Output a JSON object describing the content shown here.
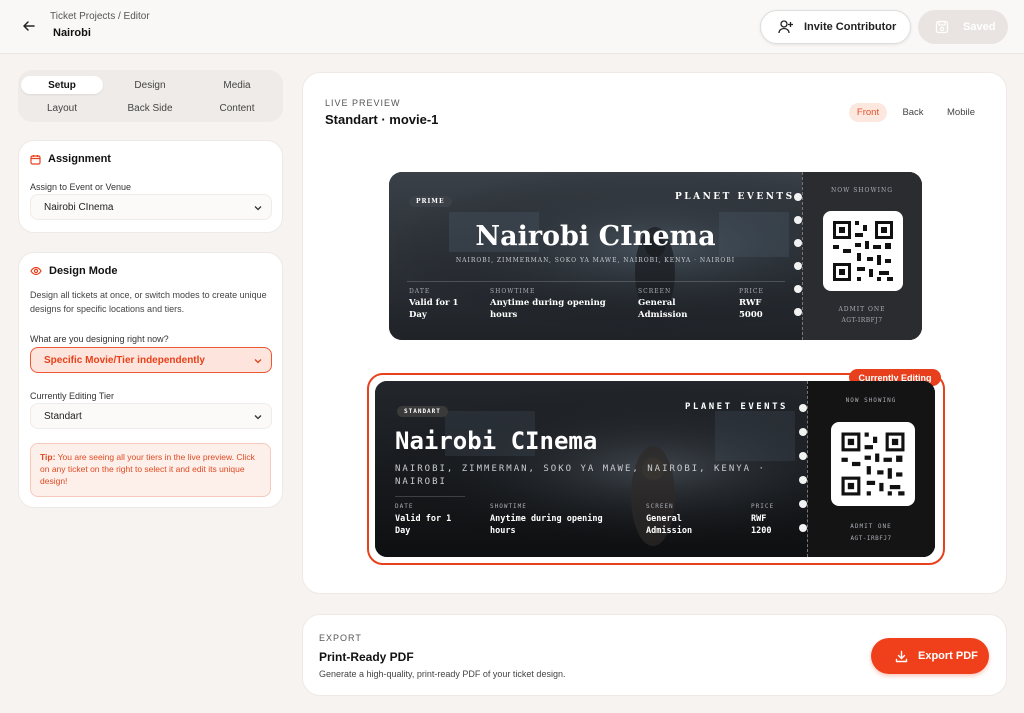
{
  "header": {
    "breadcrumb": "Ticket Projects / Editor",
    "title": "Nairobi",
    "invite_label": "Invite Contributor",
    "saved_label": "Saved"
  },
  "tabs": [
    "Setup",
    "Design",
    "Media",
    "Layout",
    "Back Side",
    "Content"
  ],
  "assignment": {
    "heading": "Assignment",
    "label": "Assign to Event or Venue",
    "value": "Nairobi CInema"
  },
  "design_mode": {
    "heading": "Design Mode",
    "description": "Design all tickets at once, or switch modes to create unique designs for specific locations and tiers.",
    "question": "What are you designing right now?",
    "mode_value": "Specific Movie/Tier independently",
    "tier_label": "Currently Editing Tier",
    "tier_value": "Standart",
    "tip_label": "Tip:",
    "tip_text": " You are seeing all your tiers in the live preview. Click on any ticket on the right to select it and edit its unique design!"
  },
  "preview": {
    "label": "LIVE PREVIEW",
    "title": "Standart · movie-1",
    "views": [
      "Front",
      "Back",
      "Mobile"
    ]
  },
  "ticket_prime": {
    "badge": "PRIME",
    "organizer": "PLANET EVENTS",
    "name": "Nairobi CInema",
    "address": "NAIROBI, ZIMMERMAN, SOKO YA MAWE, NAIROBI, KENYA · NAIROBI",
    "date_k": "DATE",
    "date_v": "Valid for 1 Day",
    "show_k": "SHOWTIME",
    "show_v": "Anytime during opening hours",
    "screen_k": "SCREEN",
    "screen_v": "General Admission",
    "price_k": "PRICE",
    "price_v": "RWF 5000",
    "now_showing": "NOW SHOWING",
    "admit": "ADMIT ONE",
    "code": "AGT-IRBFJ7"
  },
  "ticket_standart": {
    "badge": "STANDART",
    "organizer": "PLANET EVENTS",
    "name": "Nairobi CInema",
    "address": "NAIROBI, ZIMMERMAN, SOKO YA MAWE, NAIROBI, KENYA · NAIROBI",
    "date_k": "DATE",
    "date_v": "Valid for 1 Day",
    "show_k": "SHOWTIME",
    "show_v": "Anytime during opening hours",
    "screen_k": "SCREEN",
    "screen_v": "General Admission",
    "price_k": "PRICE",
    "price_v": "RWF 1200",
    "now_showing": "NOW SHOWING",
    "admit": "ADMIT ONE",
    "code": "AGT-IRBFJ7",
    "editing_badge": "Currently Editing"
  },
  "export": {
    "label": "EXPORT",
    "title": "Print-Ready PDF",
    "description": "Generate a high-quality, print-ready PDF of your ticket design.",
    "button": "Export PDF"
  },
  "colors": {
    "accent": "#f0401b",
    "accent_soft": "#fde5de"
  }
}
